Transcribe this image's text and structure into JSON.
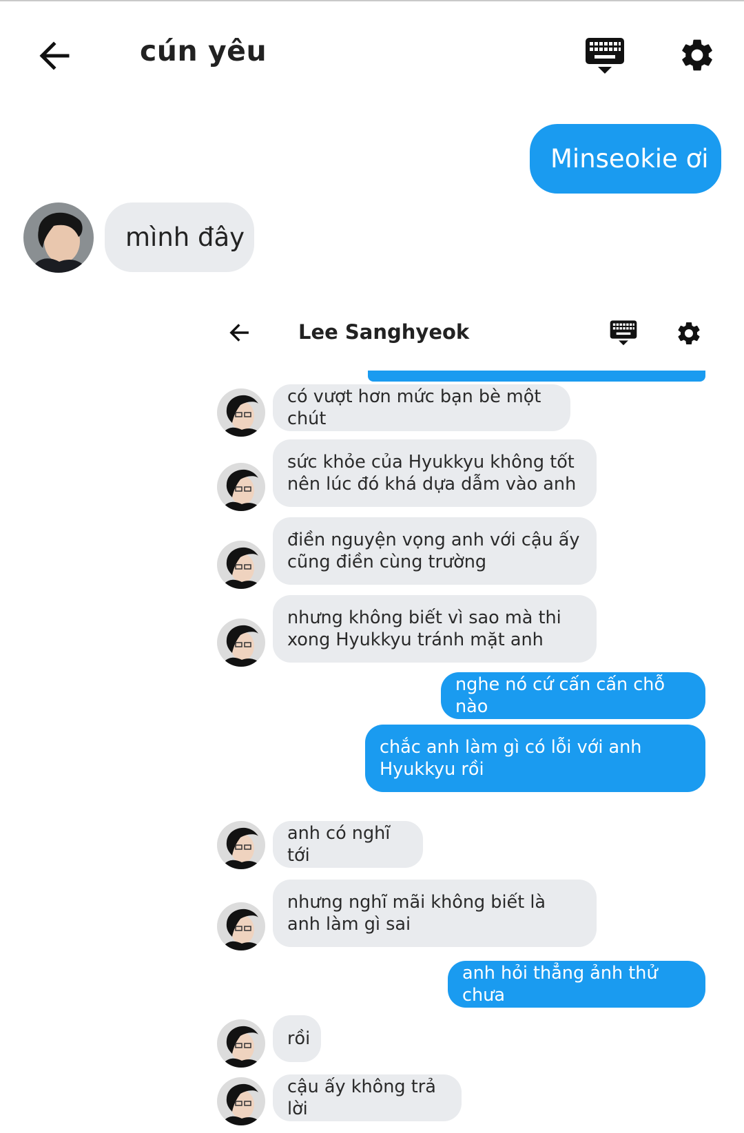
{
  "header": {
    "title": "cún yêu",
    "back_icon": "arrow-left-icon",
    "keyboard_icon": "keyboard-icon",
    "settings_icon": "gear-icon"
  },
  "outer_messages": [
    {
      "from": "me",
      "text": "Minseokie ơi"
    },
    {
      "from": "them",
      "text": "mình đây"
    }
  ],
  "inner_screenshot": {
    "title": "Lee Sanghyeok",
    "messages": [
      {
        "from": "them",
        "text": "có vượt hơn mức bạn bè một chút"
      },
      {
        "from": "them",
        "text": "sức khỏe của Hyukkyu không tốt nên lúc đó khá dựa dẫm vào anh"
      },
      {
        "from": "them",
        "text": "điền nguyện vọng anh với cậu ấy cũng điền cùng trường"
      },
      {
        "from": "them",
        "text": "nhưng không biết vì sao mà thi xong Hyukkyu tránh mặt anh"
      },
      {
        "from": "me",
        "text": "nghe nó cứ cấn cấn chỗ nào"
      },
      {
        "from": "me",
        "text": "chắc anh làm gì có lỗi với anh Hyukkyu rồi"
      },
      {
        "from": "them",
        "text": "anh có nghĩ tới"
      },
      {
        "from": "them",
        "text": "nhưng nghĩ mãi không biết là anh làm gì sai"
      },
      {
        "from": "me",
        "text": "anh hỏi thẳng ảnh thử chưa"
      },
      {
        "from": "them",
        "text": "rồi"
      },
      {
        "from": "them",
        "text": "cậu ấy không trả lời"
      }
    ]
  },
  "colors": {
    "sent_bubble": "#1a9bf0",
    "received_bubble": "#e9ebee"
  }
}
